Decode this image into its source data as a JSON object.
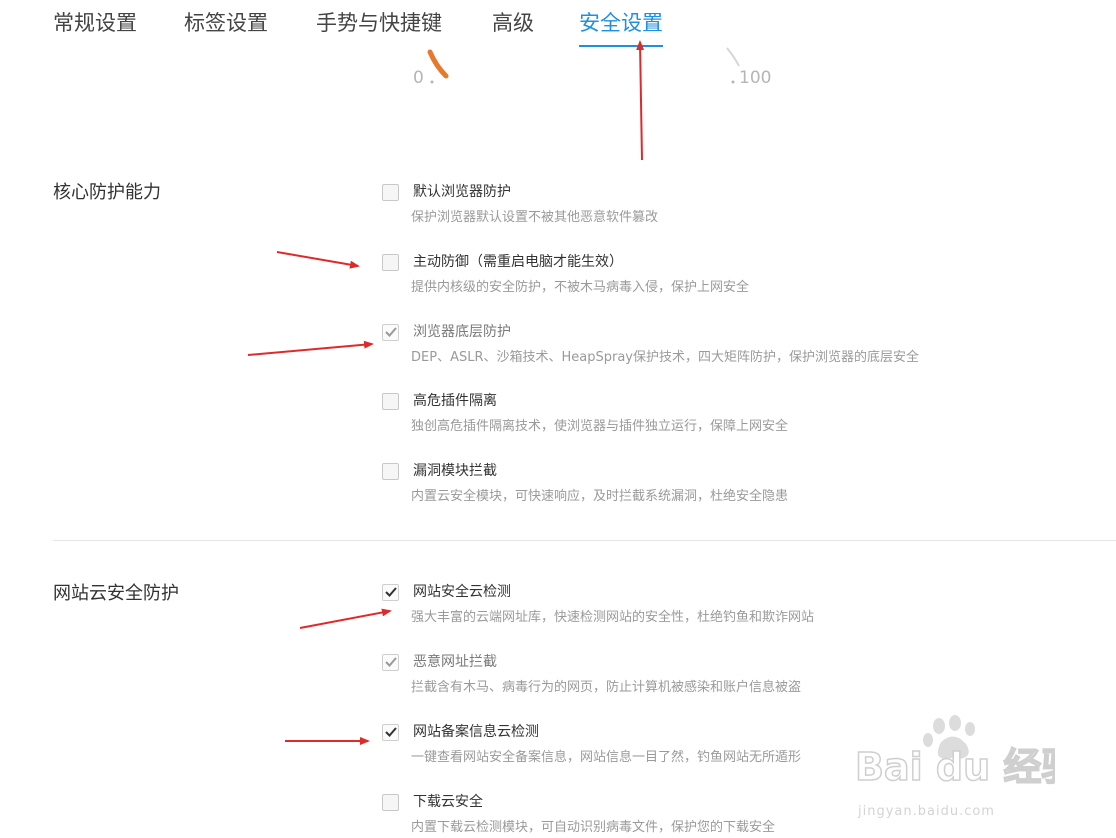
{
  "tabs": [
    {
      "label": "常规设置"
    },
    {
      "label": "标签设置"
    },
    {
      "label": "手势与快捷键"
    },
    {
      "label": "高级"
    },
    {
      "label": "安全设置",
      "active": true
    }
  ],
  "gauge": {
    "min_label": "0",
    "max_label": "100"
  },
  "sections": [
    {
      "title": "核心防护能力",
      "options": [
        {
          "label": "默认浏览器防护",
          "desc": "保护浏览器默认设置不被其他恶意软件篡改",
          "checked": false
        },
        {
          "label": "主动防御（需重启电脑才能生效）",
          "desc": "提供内核级的安全防护，不被木马病毒入侵，保护上网安全",
          "checked": false
        },
        {
          "label": "浏览器底层防护",
          "desc": "DEP、ASLR、沙箱技术、HeapSpray保护技术，四大矩阵防护，保护浏览器的底层安全",
          "checked": true,
          "dim": true
        },
        {
          "label": "高危插件隔离",
          "desc": "独创高危插件隔离技术，使浏览器与插件独立运行，保障上网安全",
          "checked": false
        },
        {
          "label": "漏洞模块拦截",
          "desc": "内置云安全模块，可快速响应，及时拦截系统漏洞，杜绝安全隐患",
          "checked": false
        }
      ]
    },
    {
      "title": "网站云安全防护",
      "options": [
        {
          "label": "网站安全云检测",
          "desc": "强大丰富的云端网址库，快速检测网站的安全性，杜绝钓鱼和欺诈网站",
          "checked": true
        },
        {
          "label": "恶意网址拦截",
          "desc": "拦截含有木马、病毒行为的网页，防止计算机被感染和账户信息被盗",
          "checked": true,
          "dim": true
        },
        {
          "label": "网站备案信息云检测",
          "desc": "一键查看网站安全备案信息，网站信息一目了然，钓鱼网站无所遁形",
          "checked": true
        },
        {
          "label": "下载云安全",
          "desc": "内置下载云检测模块，可自动识别病毒文件，保护您的下载安全",
          "checked": false
        }
      ]
    }
  ],
  "watermark": {
    "logo_text": "Bai du 经验",
    "site": "jingyan.baidu.com"
  },
  "colors": {
    "accent": "#1f8fe0",
    "arrow": "#e02a2a",
    "gauge": "#e8782a"
  },
  "icons": [
    "checkmark-icon",
    "red-arrow",
    "paw-icon"
  ]
}
